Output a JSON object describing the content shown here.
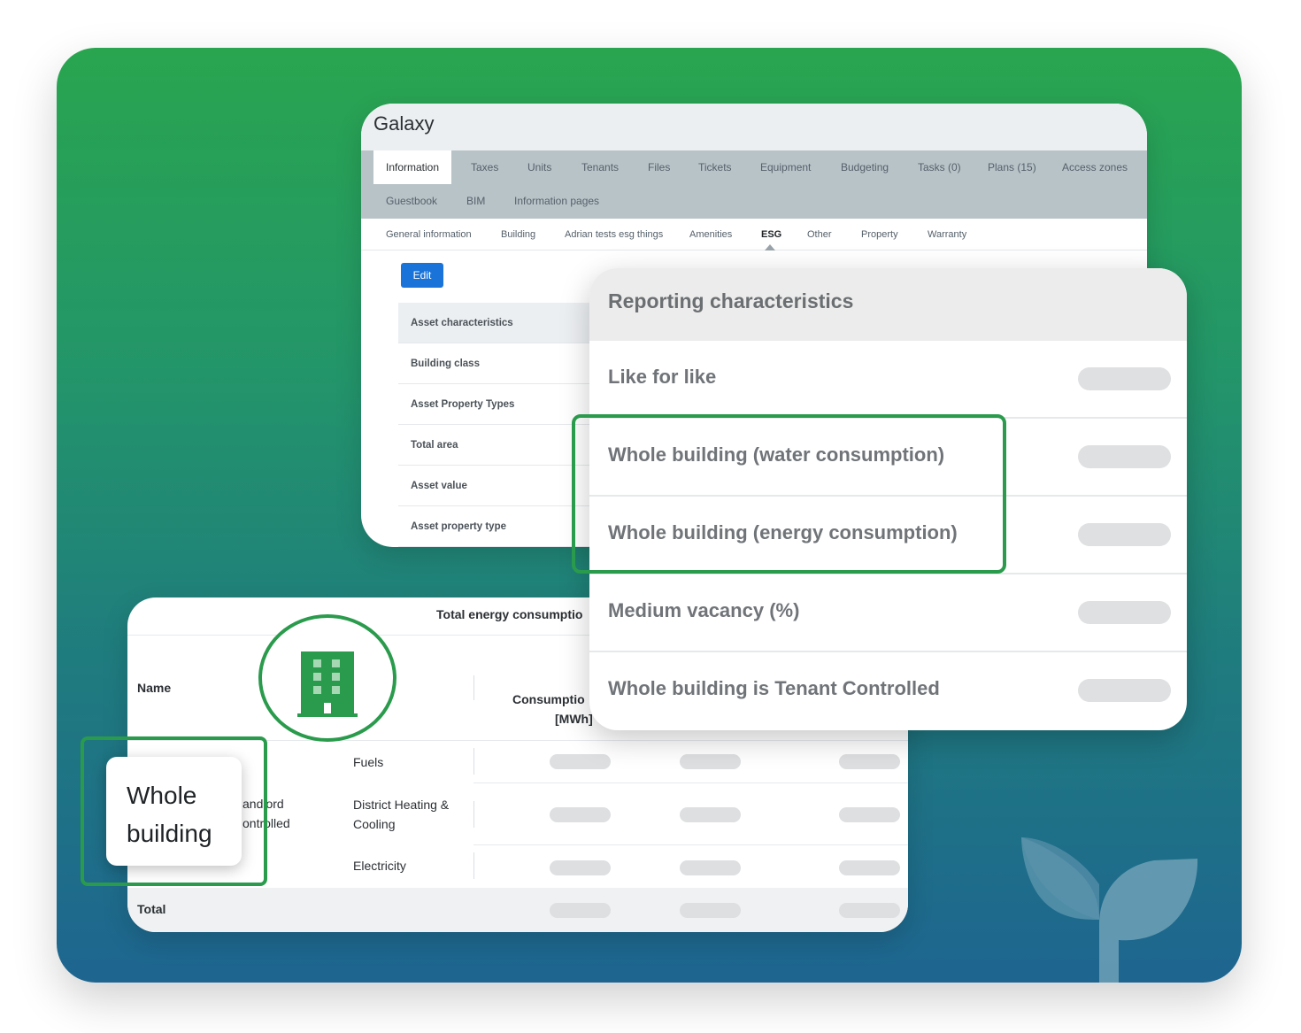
{
  "galaxy": {
    "title": "Galaxy",
    "tabs": [
      "Information",
      "Taxes",
      "Units",
      "Tenants",
      "Files",
      "Tickets",
      "Equipment",
      "Budgeting",
      "Tasks (0)",
      "Plans (15)",
      "Access zones",
      "Guestbook",
      "BIM",
      "Information pages"
    ],
    "subtabs": [
      "General information",
      "Building",
      "Adrian tests esg things",
      "Amenities",
      "ESG",
      "Other",
      "Property",
      "Warranty"
    ],
    "edit_label": "Edit",
    "characteristics": [
      "Asset characteristics",
      "Building class",
      "Asset Property Types",
      "Total area",
      "Asset value",
      "Asset property type"
    ]
  },
  "reporting": {
    "title": "Reporting characteristics",
    "rows": [
      "Like for like",
      "Whole building (water consumption)",
      "Whole building (energy consumption)",
      "Medium vacancy (%)",
      "Whole building is Tenant Controlled"
    ]
  },
  "energy": {
    "title": "Total energy consumptio",
    "name_header": "Name",
    "consumption_header_1": "Consumptio",
    "consumption_header_2": "[MWh]",
    "group_label_1": "andlord",
    "group_label_2": "ontrolled",
    "rows": [
      "Fuels",
      "District Heating &",
      "Cooling",
      "Electricity"
    ],
    "total_label": "Total"
  },
  "callout": {
    "line1": "Whole",
    "line2": "building"
  },
  "colors": {
    "brand_green": "#2a9b4c",
    "edit_blue": "#1a73d9"
  }
}
